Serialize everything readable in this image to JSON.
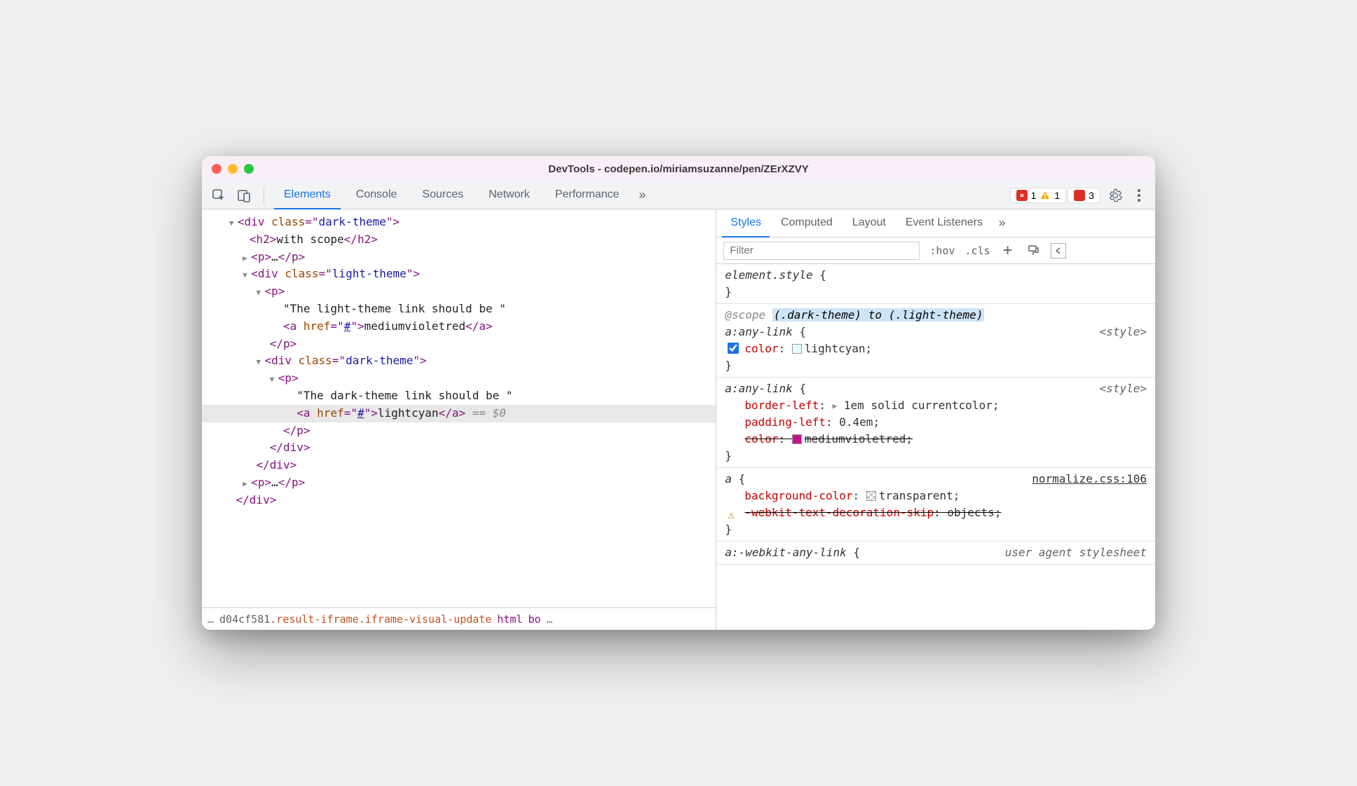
{
  "window": {
    "title": "DevTools - codepen.io/miriamsuzanne/pen/ZErXZVY"
  },
  "tabs": {
    "elements": "Elements",
    "console": "Console",
    "sources": "Sources",
    "network": "Network",
    "performance": "Performance"
  },
  "badges": {
    "errors": "1",
    "warnings": "1",
    "issues": "3"
  },
  "dom": {
    "l1": "div",
    "l1_class_attr": "class",
    "l1_class": "dark-theme",
    "l2": "h2",
    "l2_text": "with scope",
    "l3": "p",
    "l3_ellip": "…",
    "l4": "div",
    "l4_class": "light-theme",
    "l5": "p",
    "l5_text": "\"The light-theme link should be \"",
    "l6": "a",
    "l6_href_attr": "href",
    "l6_href": "#",
    "l6_text": "mediumvioletred",
    "l7": "div",
    "l7_class": "dark-theme",
    "l8": "p",
    "l8_text": "\"The dark-theme link should be \"",
    "l9": "a",
    "l9_href": "#",
    "l9_text": "lightcyan",
    "l9_eq": " == ",
    "l9_dollar": "$0"
  },
  "breadcrumb": {
    "id": "d04cf581",
    "cls": ".result-iframe.iframe-visual-update",
    "html": "html",
    "bo": "bo"
  },
  "styles": {
    "tabs": {
      "styles": "Styles",
      "computed": "Computed",
      "layout": "Layout",
      "event": "Event Listeners"
    },
    "filter_placeholder": "Filter",
    "hov": ":hov",
    "cls": ".cls",
    "r0_sel": "element.style",
    "r1_scope": "@scope",
    "r1_scope_args": "(.dark-theme) to (.light-theme)",
    "r1_sel": "a:any-link",
    "r1_src": "<style>",
    "r1_prop": "color",
    "r1_val": "lightcyan",
    "r2_sel": "a:any-link",
    "r2_src": "<style>",
    "r2_p1": "border-left",
    "r2_v1": "1em solid currentcolor",
    "r2_p2": "padding-left",
    "r2_v2": "0.4em",
    "r2_p3": "color",
    "r2_v3": "mediumvioletred",
    "r3_sel": "a",
    "r3_src": "normalize.css:106",
    "r3_p1": "background-color",
    "r3_v1": "transparent",
    "r3_p2": "-webkit-text-decoration-skip",
    "r3_v2": "objects",
    "r4_sel": "a:-webkit-any-link",
    "r4_src": "user agent stylesheet"
  }
}
